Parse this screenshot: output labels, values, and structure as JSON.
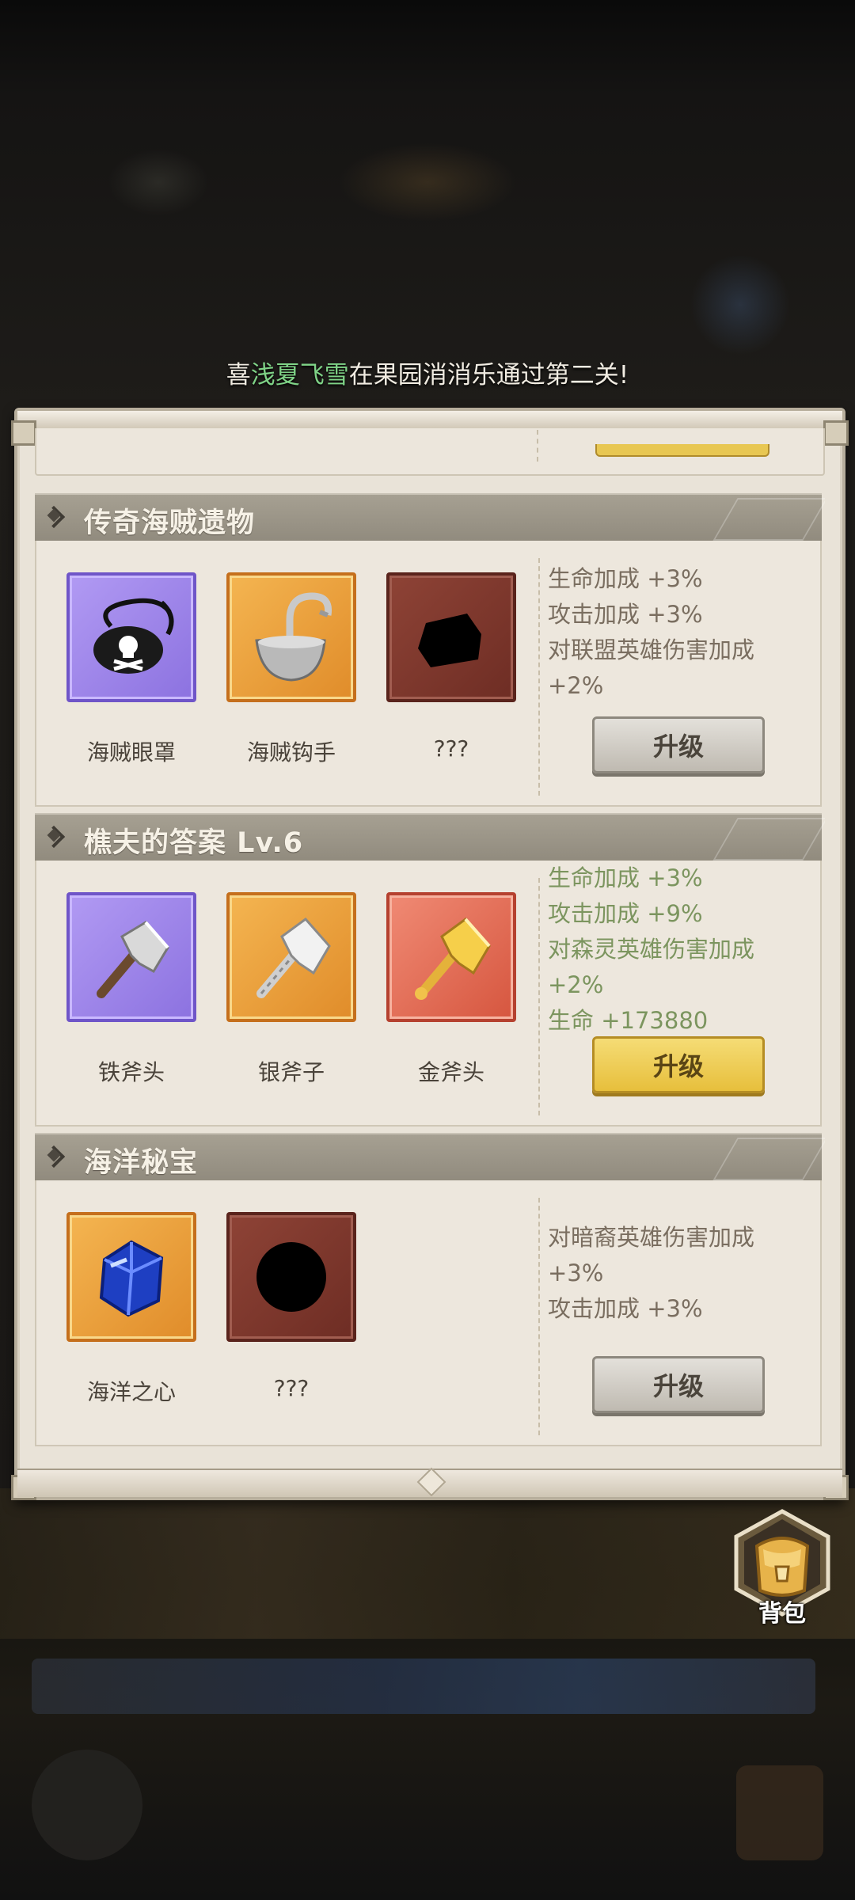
{
  "broadcast": {
    "pre": "喜",
    "name": "浅夏飞雪",
    "post": "在果园消消乐通过第二关!"
  },
  "sections": [
    {
      "title": "传奇海贼遗物",
      "items": [
        {
          "name": "海贼眼罩",
          "icon": "eyepatch-icon",
          "rarity": "purple"
        },
        {
          "name": "海贼钩手",
          "icon": "hook-icon",
          "rarity": "orange"
        },
        {
          "name": "???",
          "icon": "unknown-item-icon",
          "rarity": "dark"
        }
      ],
      "stats": [
        "生命加成 +3%",
        "攻击加成 +3%",
        "对联盟英雄伤害加成",
        "+2%"
      ],
      "stats_active": false,
      "button": {
        "label": "升级",
        "style": "grey"
      }
    },
    {
      "title": "樵夫的答案 Lv.6",
      "items": [
        {
          "name": "铁斧头",
          "icon": "iron-axe-icon",
          "rarity": "purple"
        },
        {
          "name": "银斧子",
          "icon": "silver-axe-icon",
          "rarity": "orange"
        },
        {
          "name": "金斧头",
          "icon": "gold-axe-icon",
          "rarity": "red"
        }
      ],
      "stats": [
        "生命加成 +3%",
        "攻击加成 +9%",
        "对森灵英雄伤害加成",
        "+2%",
        "生命 +173880"
      ],
      "stats_active": true,
      "button": {
        "label": "升级",
        "style": "gold"
      }
    },
    {
      "title": "海洋秘宝",
      "items": [
        {
          "name": "海洋之心",
          "icon": "ocean-gem-icon",
          "rarity": "orange"
        },
        {
          "name": "???",
          "icon": "unknown-item-icon",
          "rarity": "dark"
        }
      ],
      "stats": [
        "对暗裔英雄伤害加成",
        "+3%",
        "攻击加成 +3%"
      ],
      "stats_active": false,
      "button": {
        "label": "升级",
        "style": "grey"
      }
    }
  ],
  "bag": {
    "label": "背包",
    "icon": "backpack-icon"
  },
  "colors": {
    "active_stat": "#7c955f",
    "inactive_stat": "#7a6e60",
    "upgrade_active": "#e7bf3c"
  }
}
